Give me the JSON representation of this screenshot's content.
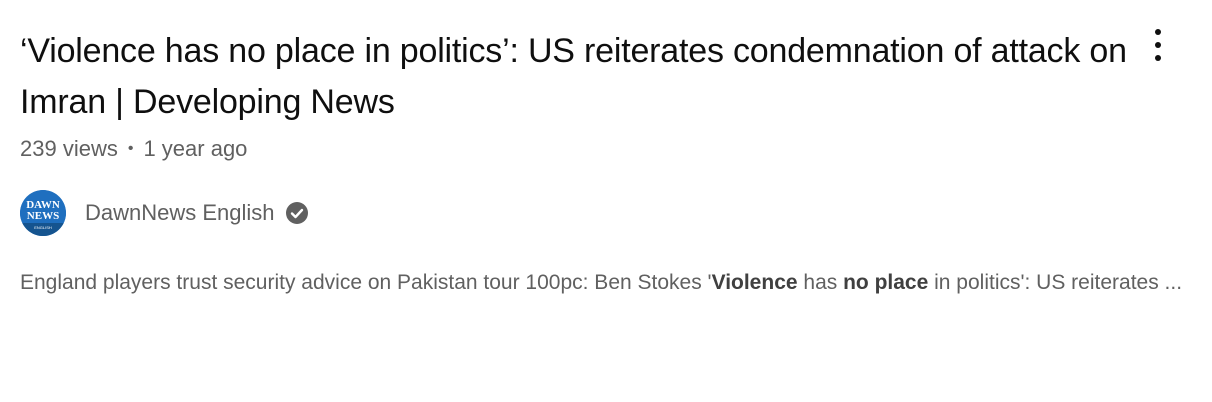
{
  "video": {
    "title": "‘Violence has no place in politics’: US reiterates condemnation of attack on Imran | Developing News",
    "views": "239 views",
    "separator": "•",
    "age": "1 year ago",
    "channel": {
      "name": "DawnNews English",
      "avatar_top": "DAWN",
      "avatar_middle": "NEWS",
      "avatar_bottom": "ENGLISH",
      "verified_icon": "verified-check-icon"
    },
    "snippet": {
      "part1": "England players trust security advice on Pakistan tour 100pc: Ben Stokes '",
      "bold1": "Violence",
      "part2": " has ",
      "bold2": "no place",
      "part3": " in politics': US reiterates ..."
    },
    "menu_icon": "more-vert-icon"
  },
  "colors": {
    "title": "#0f0f0f",
    "secondary_text": "#606060",
    "avatar_bg": "#1f6fbf",
    "verified": "#606060"
  }
}
